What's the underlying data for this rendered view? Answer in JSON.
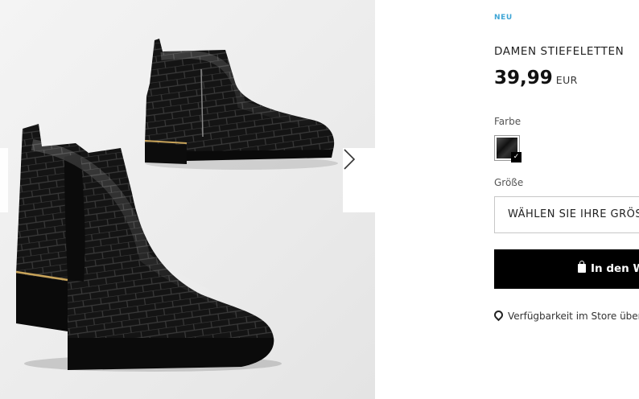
{
  "product": {
    "badge": "NEU",
    "title": "DAMEN STIEFELETTEN",
    "price": "39,99",
    "currency": "EUR"
  },
  "color": {
    "label": "Farbe",
    "selected_swatch": "black-croc",
    "check_icon": "checkmark-icon"
  },
  "size": {
    "label": "Größe",
    "placeholder": "WÄHLEN SIE IHRE GRÖSSE"
  },
  "cart": {
    "button_label": "In den Warenkorb",
    "icon": "shopping-bag-icon"
  },
  "store": {
    "link_label": "Verfügbarkeit im Store überprüfen",
    "icon": "location-pin-icon"
  },
  "gallery": {
    "next_icon": "chevron-right-icon",
    "prev_icon": "chevron-left-icon"
  },
  "colors": {
    "badge": "#3fa6d6",
    "button_bg": "#000000",
    "text": "#222222"
  }
}
